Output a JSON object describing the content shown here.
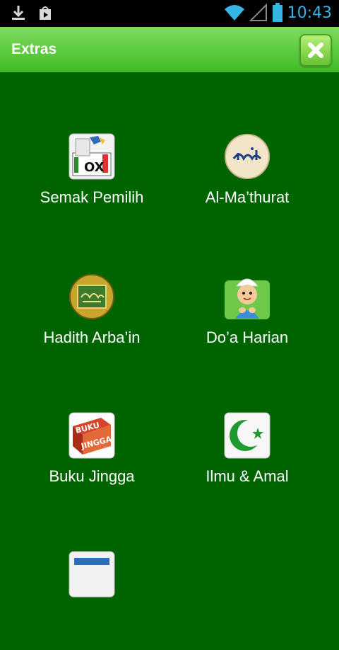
{
  "status_bar": {
    "time": "10:43",
    "icons": [
      "download-icon",
      "play-store-icon",
      "wifi-icon",
      "signal-icon",
      "battery-icon"
    ]
  },
  "action_bar": {
    "title": "Extras",
    "close_icon": "close-icon"
  },
  "menu": {
    "items": [
      {
        "label": "Semak Pemilih",
        "icon": "ballot-box-icon"
      },
      {
        "label": "Al-Ma’thurat",
        "icon": "mathurat-icon"
      },
      {
        "label": "Hadith Arba’in",
        "icon": "hadith-icon"
      },
      {
        "label": "Do’a Harian",
        "icon": "doa-boy-icon"
      },
      {
        "label": "Buku Jingga",
        "icon": "buku-jingga-icon"
      },
      {
        "label": "Ilmu & Amal",
        "icon": "crescent-star-icon"
      },
      {
        "label": "",
        "icon": "partial-icon"
      }
    ],
    "icon_text": {
      "buku": "BUKU",
      "jingga": "JINGGA"
    }
  },
  "colors": {
    "background": "#006400",
    "action_bar_top": "#7edb5e",
    "action_bar_bottom": "#3fbb26",
    "status_accent": "#33b5e5"
  }
}
